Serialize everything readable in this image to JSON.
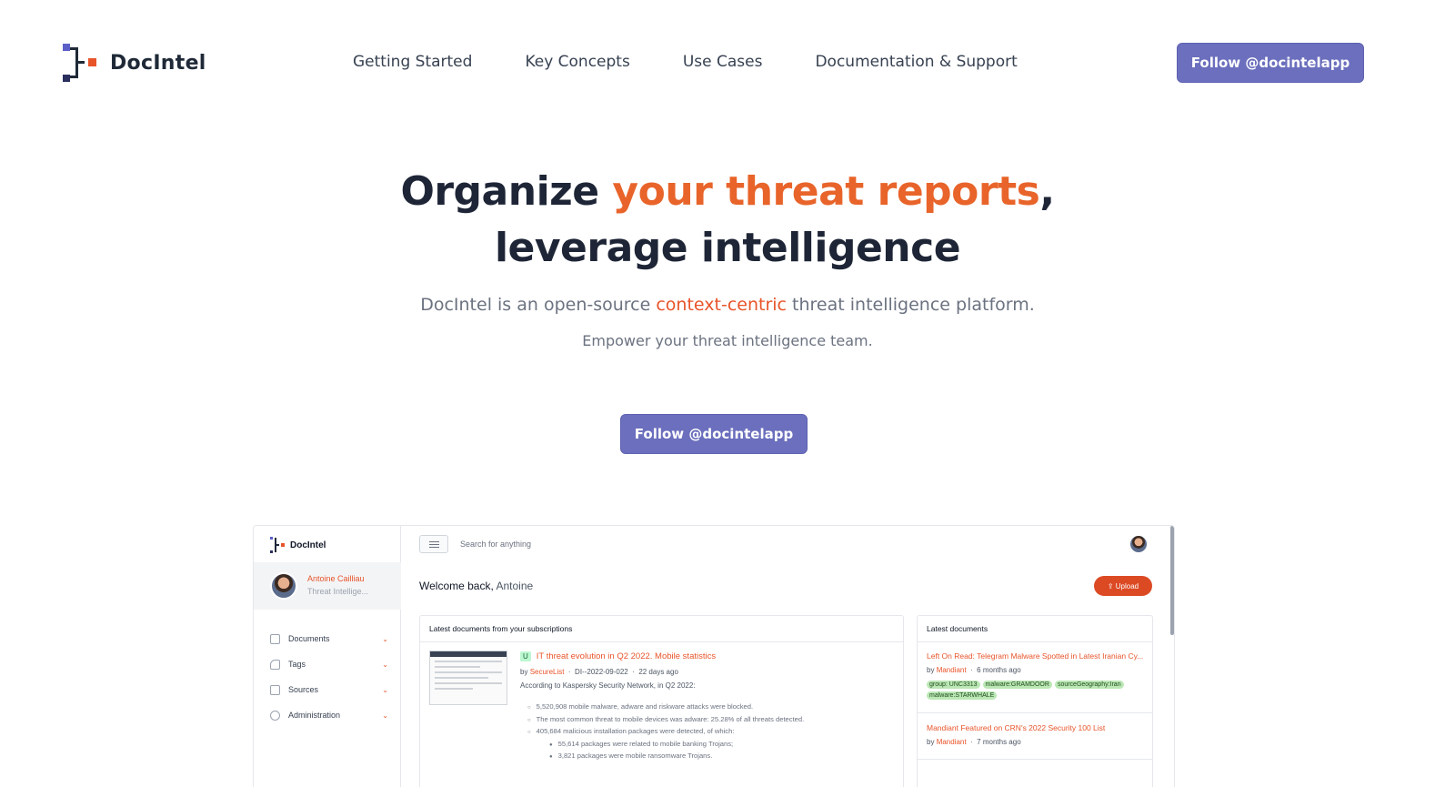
{
  "nav": {
    "brand": "DocIntel",
    "links": [
      "Getting Started",
      "Key Concepts",
      "Use Cases",
      "Documentation & Support"
    ],
    "follow_button": "Follow @docintelapp"
  },
  "hero": {
    "title_part1": "Organize ",
    "title_accent": "your threat reports",
    "title_part2": ",",
    "title_line2": "leverage intelligence",
    "tagline_before": "DocIntel is an open-source ",
    "tagline_accent": "context-centric",
    "tagline_after": " threat intelligence platform.",
    "subline": "Empower your threat intelligence team.",
    "follow_button": "Follow @docintelapp"
  },
  "colors": {
    "accent_orange": "#e8642a",
    "button_purple": "#6b6fbd",
    "heading": "#1e2536"
  },
  "app": {
    "brand": "DocIntel",
    "user": {
      "name": "Antoine Cailliau",
      "role": "Threat Intellige..."
    },
    "sidebar": [
      {
        "label": "Documents",
        "icon": "document-icon"
      },
      {
        "label": "Tags",
        "icon": "tag-icon"
      },
      {
        "label": "Sources",
        "icon": "source-icon"
      },
      {
        "label": "Administration",
        "icon": "gear-icon"
      }
    ],
    "search_placeholder": "Search for anything",
    "welcome_prefix": "Welcome back,",
    "welcome_name": " Antoine",
    "upload_label": "Upload",
    "subscriptions": {
      "header": "Latest documents from your subscriptions",
      "doc": {
        "badge": "U",
        "title": "IT threat evolution in Q2 2022. Mobile statistics",
        "by": "by",
        "source": "SecureList",
        "ref": "DI--2022-09-022",
        "age": "22 days ago",
        "description": "According to Kaspersky Security Network, in Q2 2022:",
        "bullets": [
          {
            "text": "5,520,908 mobile malware, adware and riskware attacks were blocked.",
            "sub": false
          },
          {
            "text": "The most common threat to mobile devices was adware: 25.28% of all threats detected.",
            "sub": false
          },
          {
            "text": "405,684 malicious installation packages were detected, of which:",
            "sub": false
          },
          {
            "text": "55,614 packages were related to mobile banking Trojans;",
            "sub": true
          },
          {
            "text": "3,821 packages were mobile ransomware Trojans.",
            "sub": true
          }
        ]
      }
    },
    "latest": {
      "header": "Latest documents",
      "docs": [
        {
          "title": "Left On Read: Telegram Malware Spotted in Latest Iranian Cy...",
          "by": "by",
          "source": "Mandiant",
          "age": "6 months ago",
          "tags": [
            "group: UNC3313",
            "malware:GRAMDOOR",
            "sourceGeography:Iran",
            "malware:STARWHALE"
          ]
        },
        {
          "title": "Mandiant Featured on CRN's 2022 Security 100 List",
          "by": "by",
          "source": "Mandiant",
          "age": "7 months ago",
          "tags": []
        }
      ]
    }
  }
}
